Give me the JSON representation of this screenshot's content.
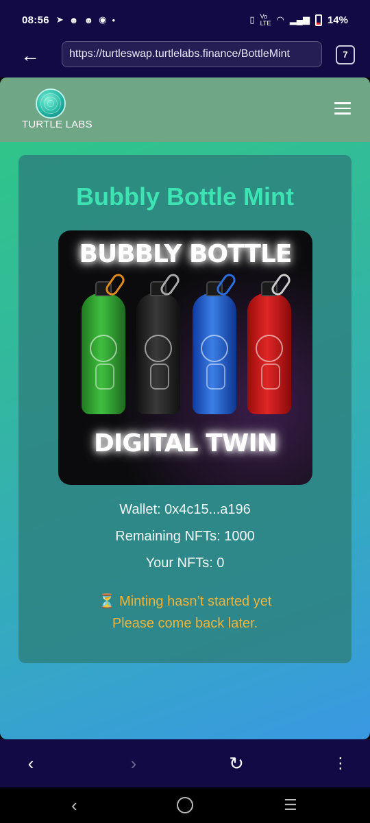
{
  "status_bar": {
    "time": "08:56",
    "battery_percent": "14%",
    "left_icons": [
      "telegram-icon",
      "discord-icon",
      "discord-icon",
      "messenger-icon",
      "dot-icon"
    ],
    "right_icons": [
      "vibrate-icon",
      "volte-icon",
      "wifi-icon",
      "signal-icon",
      "battery-charging-icon"
    ]
  },
  "browser": {
    "url": "https://turtleswap.turtlelabs.finance/BottleMint",
    "tab_count": "7"
  },
  "site": {
    "logo_text": "TURTLE LABS"
  },
  "mint_card": {
    "title": "Bubbly Bottle Mint",
    "image_heading_top": "BUBBLY BOTTLE",
    "image_heading_bottom": "DIGITAL TWIN",
    "wallet": "Wallet: 0x4c15...a196",
    "remaining": "Remaining NFTs: 1000",
    "your_nfts": "Your NFTs: 0",
    "status_line1": "⏳ Minting hasn’t started yet",
    "status_line2": "Please come back later."
  },
  "colors": {
    "title_accent": "#3de3b2",
    "warning": "#f0b43a",
    "chrome": "#110a45"
  }
}
